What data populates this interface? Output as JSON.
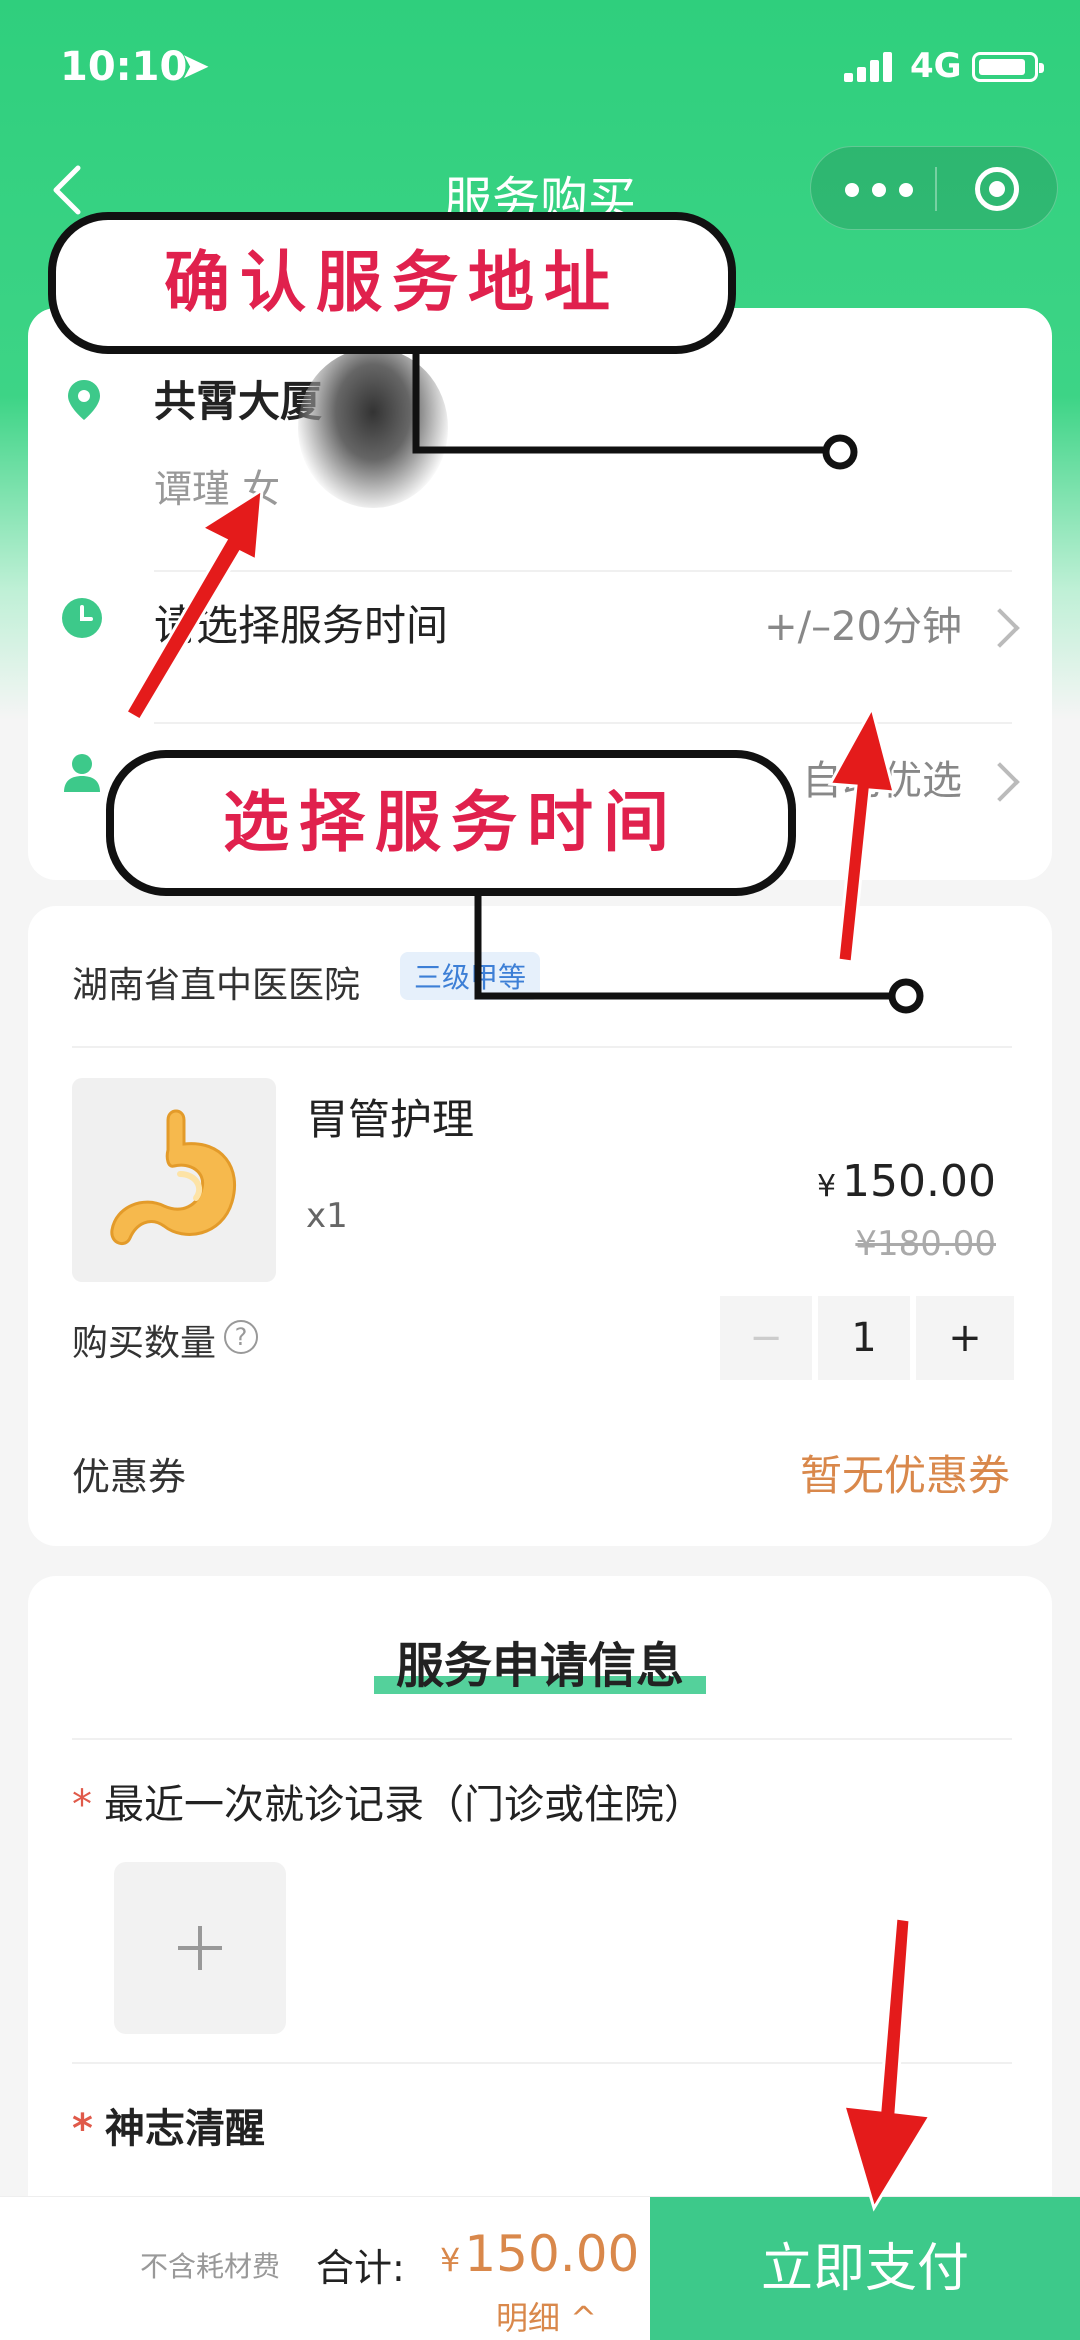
{
  "status_bar": {
    "time": "10:10",
    "network": "4G"
  },
  "nav": {
    "title": "服务购买"
  },
  "address": {
    "name": "共霄大厦",
    "person": "谭瑾 女"
  },
  "service_time": {
    "label": "请选择服务时间",
    "value": "+/–20分钟"
  },
  "caregiver": {
    "value": "自动优选"
  },
  "hospital": {
    "name": "湖南省直中医医院",
    "badge": "三级甲等"
  },
  "product": {
    "name": "胃管护理",
    "qty": "x1",
    "currency": "¥",
    "price": "150.00",
    "original_price": "¥180.00"
  },
  "quantity": {
    "label": "购买数量",
    "help": "?",
    "minus": "−",
    "value": "1",
    "plus": "+"
  },
  "coupon": {
    "label": "优惠券",
    "value": "暂无优惠券"
  },
  "apply": {
    "title": "服务申请信息",
    "fields": [
      {
        "required": "*",
        "label": "最近一次就诊记录（门诊或住院）"
      },
      {
        "required": "*",
        "label": "神志清醒"
      }
    ]
  },
  "bottom_bar": {
    "note": "不含耗材费",
    "total_label": "合计:",
    "currency": "¥",
    "total": "150.00",
    "detail": "明细 ^",
    "pay": "立即支付"
  },
  "annotations": {
    "confirm_address": "确认服务地址",
    "choose_time": "选择服务时间"
  },
  "colors": {
    "brand_green": "#3dc98a",
    "price_orange": "#d9884b",
    "annotation_red": "#e0214d"
  }
}
